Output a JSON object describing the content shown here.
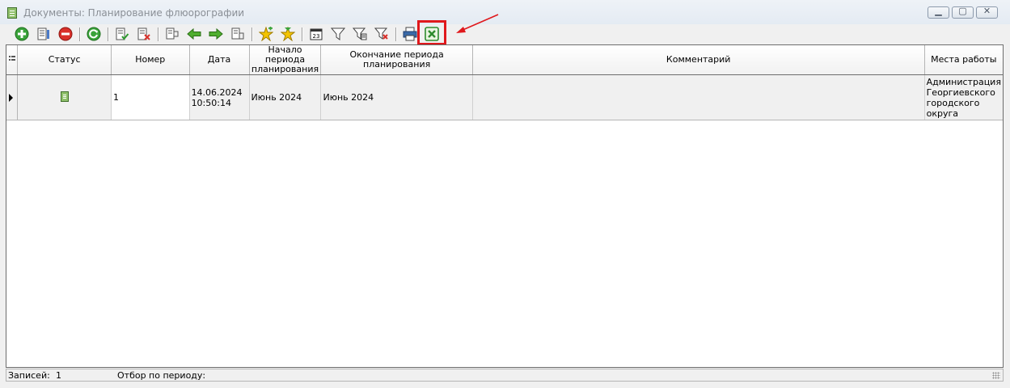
{
  "window": {
    "title": "Документы: Планирование флюорографии",
    "minimize_glyph": "▁",
    "maximize_glyph": "▢",
    "close_glyph": "✕"
  },
  "toolbar": {
    "buttons": [
      {
        "icon": "add-icon"
      },
      {
        "icon": "edit-document-icon"
      },
      {
        "icon": "delete-icon"
      },
      {
        "icon": "refresh-icon"
      },
      {
        "icon": "post-document-icon"
      },
      {
        "icon": "unpost-document-icon"
      },
      {
        "icon": "document-structure-icon"
      },
      {
        "icon": "arrow-left-icon"
      },
      {
        "icon": "arrow-right-icon"
      },
      {
        "icon": "document-tree-icon"
      },
      {
        "icon": "star-add-icon"
      },
      {
        "icon": "star-down-icon"
      },
      {
        "icon": "calendar-period-icon"
      },
      {
        "icon": "filter-icon"
      },
      {
        "icon": "filter-edit-icon"
      },
      {
        "icon": "filter-clear-icon"
      },
      {
        "icon": "print-icon"
      },
      {
        "icon": "excel-export-icon"
      }
    ],
    "highlight_color": "#e0181c"
  },
  "table": {
    "columns": [
      "Статус",
      "Номер",
      "Дата",
      "Начало периода планирования",
      "Окончание периода планирования",
      "Комментарий",
      "Места работы"
    ],
    "rows": [
      {
        "status_icon": "document-green-icon",
        "number": "1",
        "date": "14.06.2024",
        "time": "10:50:14",
        "start": "Июнь 2024",
        "end": "Июнь 2024",
        "comment": "",
        "workplace": "Администрация Георгиевского городского округа"
      }
    ]
  },
  "statusbar": {
    "records_label": "Записей:",
    "records_value": "1",
    "period_label": "Отбор по периоду:"
  }
}
